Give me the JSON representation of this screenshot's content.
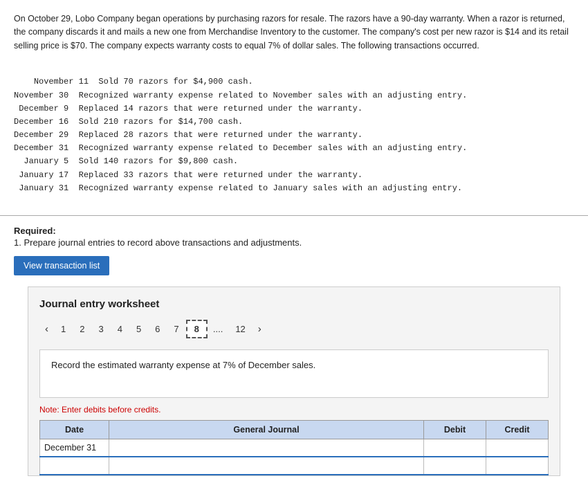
{
  "description": {
    "paragraph": "On October 29, Lobo Company began operations by purchasing razors for resale. The razors have a 90-day warranty. When a razor is returned, the company discards it and mails a new one from Merchandise Inventory to the customer. The company's cost per new razor is $14 and its retail selling price is $70. The company expects warranty costs to equal 7% of dollar sales. The following transactions occurred."
  },
  "transactions": [
    "November 11  Sold 70 razors for $4,900 cash.",
    "November 30  Recognized warranty expense related to November sales with an adjusting entry.",
    " December 9  Replaced 14 razors that were returned under the warranty.",
    "December 16  Sold 210 razors for $14,700 cash.",
    "December 29  Replaced 28 razors that were returned under the warranty.",
    "December 31  Recognized warranty expense related to December sales with an adjusting entry.",
    "  January 5  Sold 140 razors for $9,800 cash.",
    " January 17  Replaced 33 razors that were returned under the warranty.",
    " January 31  Recognized warranty expense related to January sales with an adjusting entry."
  ],
  "required": {
    "label": "Required:",
    "sub": "1. Prepare journal entries to record above transactions and adjustments."
  },
  "btn_view": "View transaction list",
  "worksheet": {
    "title": "Journal entry worksheet",
    "pages": [
      "1",
      "2",
      "3",
      "4",
      "5",
      "6",
      "7",
      "8",
      "12"
    ],
    "active_page": "8",
    "dots_after": "8",
    "instruction": "Record the estimated warranty expense at 7% of December sales.",
    "note": "Note: Enter debits before credits.",
    "table": {
      "headers": [
        "Date",
        "General Journal",
        "Debit",
        "Credit"
      ],
      "rows": [
        {
          "date": "December 31",
          "journal": "",
          "debit": "",
          "credit": ""
        }
      ]
    }
  }
}
